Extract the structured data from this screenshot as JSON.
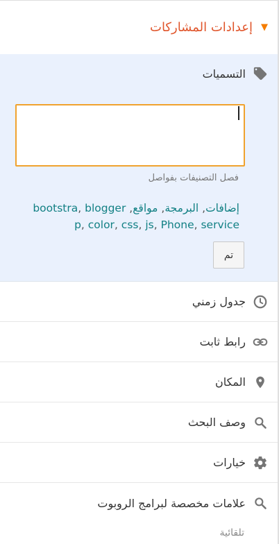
{
  "header": {
    "title": "إعدادات المشاركات",
    "caret_icon": "caret-down-icon",
    "accent": "#e0552b"
  },
  "labels": {
    "title": "التسميات",
    "input_value": "",
    "hint": "فصل التصنيفات بفواصل",
    "suggestions": [
      "إضافات",
      "البرمجة",
      "مواقع",
      "bootstra",
      "blogger",
      "p",
      "color",
      "css",
      "js",
      "Phone",
      "service"
    ],
    "done_label": "تم",
    "link_color": "#128084",
    "bg_color": "#eaf1fd"
  },
  "rows": [
    {
      "label": "جدول زمني",
      "icon": "clock-icon"
    },
    {
      "label": "رابط ثابت",
      "icon": "link-icon"
    },
    {
      "label": "المكان",
      "icon": "location-pin-icon"
    },
    {
      "label": "وصف البحث",
      "icon": "search-icon"
    },
    {
      "label": "خيارات",
      "icon": "gear-icon"
    },
    {
      "label": "علامات مخصصة لبرامج الروبوت",
      "icon": "search-icon"
    }
  ],
  "footer": {
    "sub_label": "تلقائية"
  }
}
